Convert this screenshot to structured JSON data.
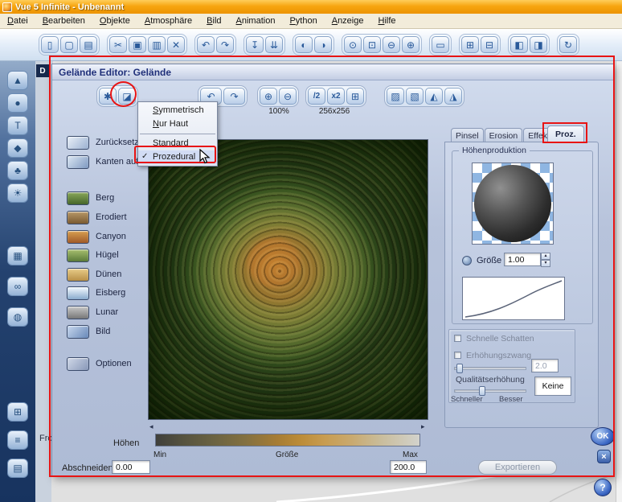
{
  "window": {
    "title": "Vue 5 Infinite - Unbenannt"
  },
  "menubar": {
    "items": [
      "Datei",
      "Bearbeiten",
      "Objekte",
      "Atmosphäre",
      "Bild",
      "Animation",
      "Python",
      "Anzeige",
      "Hilfe"
    ]
  },
  "main_toolbar": {
    "glyphs": [
      "▯",
      "▢",
      "▤",
      "✂",
      "▣",
      "▥",
      "✕",
      "↶",
      "↷",
      "↧",
      "⇊",
      "◐",
      "◑",
      "⊙",
      "⊡",
      "⊖",
      "⊕",
      "▭",
      "⊞",
      "⊟",
      "◧",
      "◨",
      "↻"
    ]
  },
  "side_toolbar": {
    "glyphs": [
      "▲",
      "●",
      "T",
      "◆",
      "♣",
      "☀",
      "▦",
      "∞",
      "◍",
      "⊞",
      "≡",
      "▤"
    ]
  },
  "background": {
    "viewport_letter": "D",
    "viewport_fragment": "Fro"
  },
  "annotation_color": "#e81414",
  "dialog": {
    "title": "Gelände Editor: Gelände",
    "toolbar": {
      "new_glyph": "✱",
      "erase_glyph": "◪",
      "undo_glyph": "↶",
      "redo_glyph": "↷",
      "zoom_in_glyph": "⊕",
      "zoom_out_glyph": "⊖",
      "half": "/2",
      "double": "x2",
      "resize_glyph": "⊞",
      "zoom_value": "100%",
      "resolution": "256x256",
      "clip_glyphs": [
        "▨",
        "▧",
        "◭",
        "◮"
      ]
    },
    "dropdown": {
      "check": "✓",
      "items": [
        "Symmetrisch",
        "Nur Haut",
        "Standard",
        "Prozedural"
      ]
    },
    "presets": [
      {
        "label": "Zurücksetze"
      },
      {
        "label": "Kanten auf"
      },
      {
        "label": "Berg"
      },
      {
        "label": "Erodiert"
      },
      {
        "label": "Canyon"
      },
      {
        "label": "Hügel"
      },
      {
        "label": "Dünen"
      },
      {
        "label": "Eisberg"
      },
      {
        "label": "Lunar"
      },
      {
        "label": "Bild"
      },
      {
        "label": "Optionen"
      }
    ],
    "tabs": {
      "pinsel": "Pinsel",
      "erosion": "Erosion",
      "effekte": "Effekte",
      "proz": "Proz."
    },
    "height_production": {
      "title": "Höhenproduktion",
      "size_label": "Größe",
      "size_value": "1.00",
      "spin_up": "▴",
      "spin_down": "▾"
    },
    "options": {
      "fast_shadows": "Schnelle Schatten",
      "altitude": "Erhöhungszwang",
      "altitude_value": "2.0",
      "quality": "Qualitätserhöhung",
      "faster": "Schneller",
      "better": "Besser",
      "quality_value": "Keine"
    },
    "bottom": {
      "heights": "Höhen",
      "min": "Min",
      "size": "Größe",
      "max": "Max",
      "clip": "Abschneiden",
      "clip_value": "0.00",
      "max_value": "200.0",
      "export": "Exportieren"
    },
    "controls": {
      "ok": "OK",
      "close": "×",
      "help": "?"
    },
    "scroll": {
      "left": "◂",
      "right": "▸"
    }
  }
}
